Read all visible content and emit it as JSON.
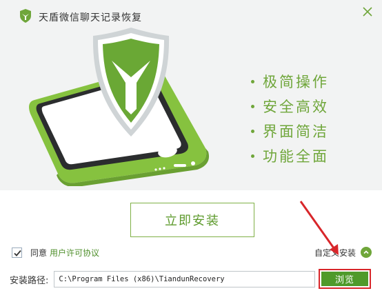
{
  "window": {
    "title": "天盾微信聊天记录恢复",
    "close_icon": "close-icon",
    "logo_icon": "shield-logo-icon"
  },
  "banner": {
    "features": [
      "极简操作",
      "安全高效",
      "界面简洁",
      "功能全面"
    ],
    "illustration": "phone-with-shield-illustration",
    "accent_color": "#6fa63a"
  },
  "actions": {
    "install_label": "立即安装",
    "agree_text": "同意",
    "license_link": "用户许可协议",
    "agree_checked": true,
    "custom_install_label": "自定义安装",
    "custom_install_icon": "chevron-up-icon"
  },
  "path": {
    "label": "安装路径:",
    "value": "C:\\Program Files (x86)\\TiandunRecovery",
    "browse_label": "浏览"
  },
  "colors": {
    "brand_green": "#6fa63a",
    "button_green": "#4f9a2a",
    "annotation_red": "#d8262a"
  }
}
